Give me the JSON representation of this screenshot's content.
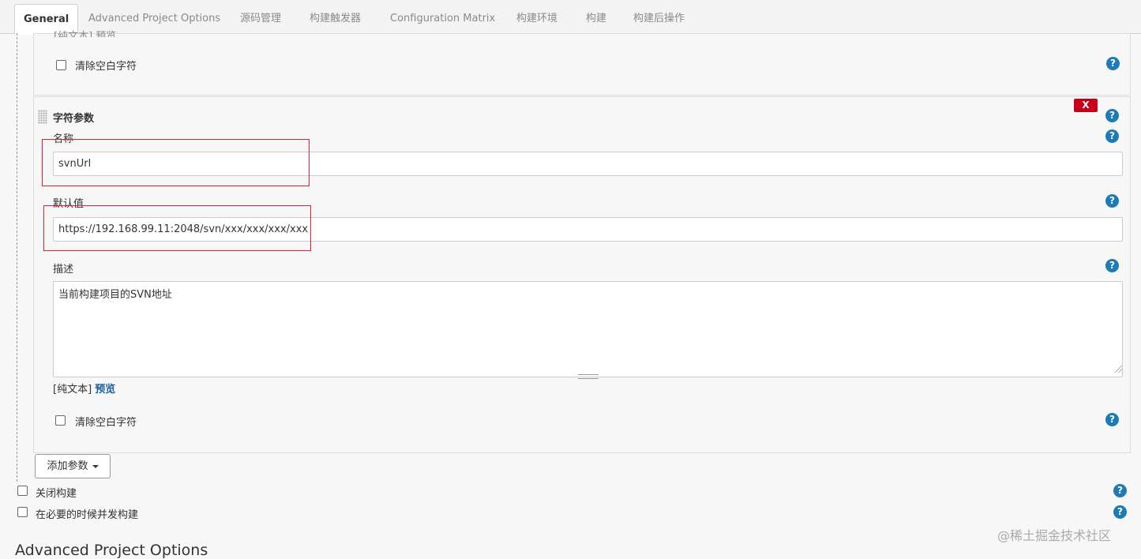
{
  "tabs": [
    {
      "label": "General"
    },
    {
      "label": "Advanced Project Options"
    },
    {
      "label": "源码管理"
    },
    {
      "label": "构建触发器"
    },
    {
      "label": "Configuration Matrix"
    },
    {
      "label": "构建环境"
    },
    {
      "label": "构建"
    },
    {
      "label": "构建后操作"
    }
  ],
  "prev_param": {
    "partial_text": "[纯文本] 预览",
    "trim_label": "清除空白字符"
  },
  "string_param": {
    "title": "字符参数",
    "delete_label": "X",
    "name_label": "名称",
    "name_value": "svnUrl",
    "default_label": "默认值",
    "default_value": "https://192.168.99.11:2048/svn/xxx/xxx/xxx/xxx",
    "desc_label": "描述",
    "desc_value": "当前构建项目的SVN地址",
    "format_prefix": "[纯文本]",
    "preview_label": "预览",
    "trim_label": "清除空白字符"
  },
  "add_param_label": "添加参数",
  "options": {
    "disable_build": "关闭构建",
    "concurrent_build": "在必要的时候并发构建"
  },
  "help_icon": "?",
  "section_title": "Advanced Project Options",
  "watermark": "@稀土掘金技术社区",
  "colors": {
    "accent": "#1e7bb5",
    "delete": "#c7001a",
    "highlight": "#d9232e"
  }
}
